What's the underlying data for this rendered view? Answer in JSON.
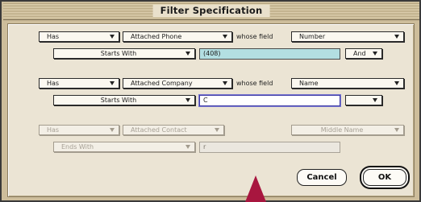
{
  "window": {
    "title": "Filter Specification"
  },
  "rows": [
    {
      "type": "Has",
      "relation": "Attached Phone",
      "whose_label": "whose field",
      "field": "Number",
      "operator": "Starts With",
      "value": "(408)",
      "conjunction": "And"
    },
    {
      "type": "Has",
      "relation": "Attached Company",
      "whose_label": "whose field",
      "field": "Name",
      "operator": "Starts With",
      "value": "C",
      "conjunction": ""
    },
    {
      "type": "Has",
      "relation": "Attached Contact",
      "field": "Middle Name",
      "operator": "Ends With",
      "value": "r"
    }
  ],
  "buttons": {
    "cancel": "Cancel",
    "ok": "OK"
  },
  "colors": {
    "window_background": "#cdbd9b",
    "panel_background": "#ebe4d4",
    "active_field": "#b3dfe2",
    "focus_outline": "#3d3aa6",
    "pointer": "#a8163f"
  }
}
